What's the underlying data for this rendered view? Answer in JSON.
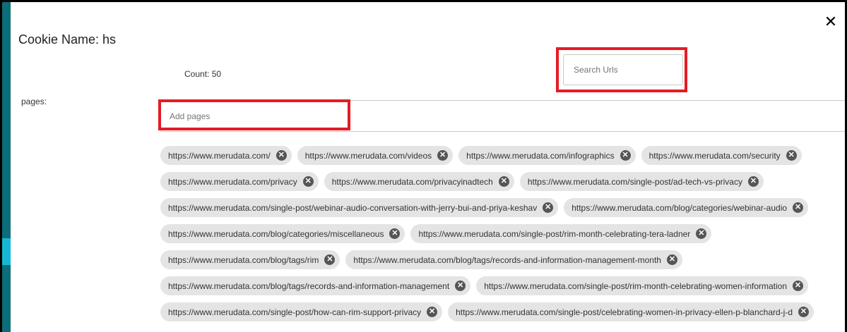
{
  "modal": {
    "close_glyph": "✕",
    "title": "Cookie Name: hs",
    "count": "Count: 50",
    "search": {
      "placeholder": "Search Urls"
    },
    "pages_label": "pages:",
    "add_pages": {
      "placeholder": "Add pages"
    },
    "remove_glyph": "✕",
    "chips": [
      "https://www.merudata.com/",
      "https://www.merudata.com/videos",
      "https://www.merudata.com/infographics",
      "https://www.merudata.com/security",
      "https://www.merudata.com/privacy",
      "https://www.merudata.com/privacyinadtech",
      "https://www.merudata.com/single-post/ad-tech-vs-privacy",
      "https://www.merudata.com/single-post/webinar-audio-conversation-with-jerry-bui-and-priya-keshav",
      "https://www.merudata.com/blog/categories/webinar-audio",
      "https://www.merudata.com/blog/categories/miscellaneous",
      "https://www.merudata.com/single-post/rim-month-celebrating-tera-ladner",
      "https://www.merudata.com/blog/tags/rim",
      "https://www.merudata.com/blog/tags/records-and-information-management-month",
      "https://www.merudata.com/blog/tags/records-and-information-management",
      "https://www.merudata.com/single-post/rim-month-celebrating-women-information",
      "https://www.merudata.com/single-post/how-can-rim-support-privacy",
      "https://www.merudata.com/single-post/celebrating-women-in-privacy-ellen-p-blanchard-j-d"
    ]
  },
  "colors": {
    "highlight": "#e51b24",
    "sidebar": "#0b6e78",
    "sidebar_accent": "#16b7d6",
    "chip_bg": "#e4e4e4",
    "chip_remove": "#555555"
  }
}
